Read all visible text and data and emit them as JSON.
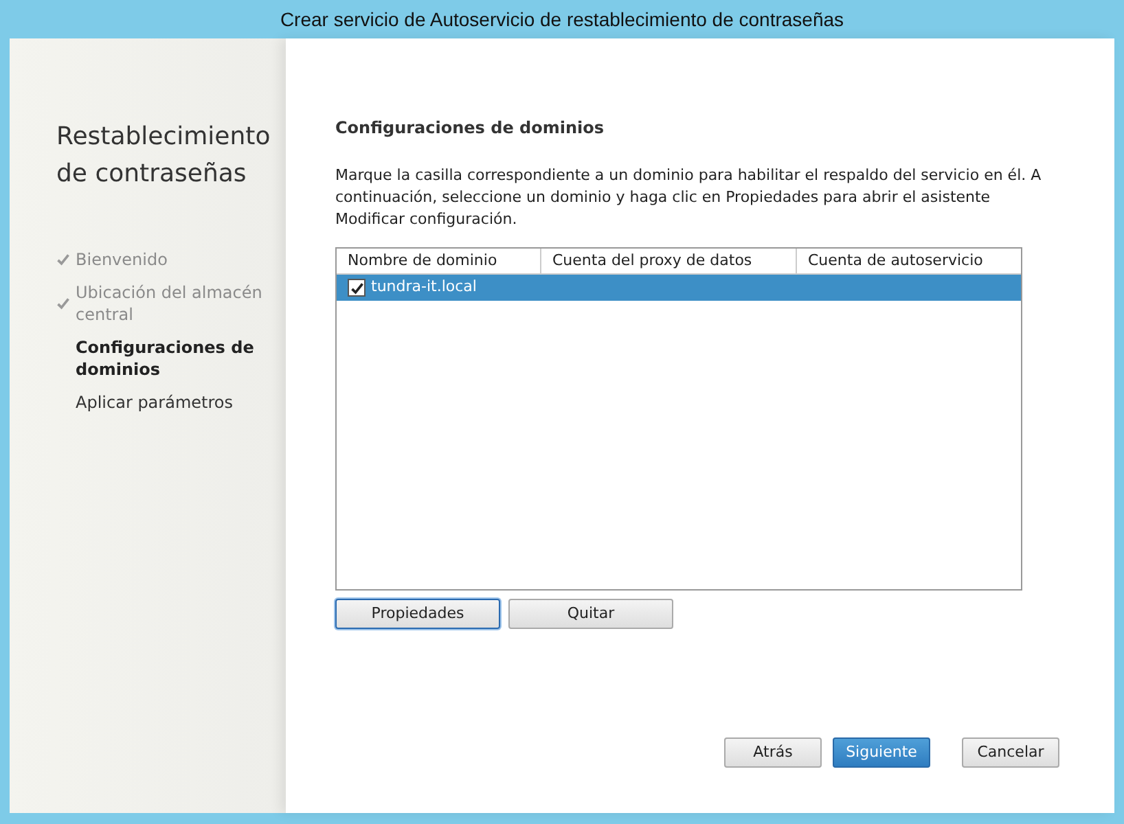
{
  "window": {
    "title": "Crear servicio de Autoservicio de restablecimiento de contraseñas"
  },
  "sidebar": {
    "title": "Restablecimiento de contraseñas",
    "steps": [
      {
        "label": "Bienvenido",
        "kind": "done"
      },
      {
        "label": "Ubicación del almacén central",
        "kind": "done"
      },
      {
        "label": "Configuraciones de dominios",
        "kind": "current"
      },
      {
        "label": "Aplicar parámetros",
        "kind": "pending"
      }
    ]
  },
  "page": {
    "heading": "Configuraciones de dominios",
    "description": "Marque la casilla correspondiente a un dominio para habilitar el respaldo del servicio en él. A continuación, seleccione un dominio y haga clic en Propiedades para abrir el asistente Modificar configuración."
  },
  "table": {
    "columns": [
      "Nombre de dominio",
      "Cuenta del proxy de datos",
      "Cuenta de autoservicio"
    ],
    "rows": [
      {
        "name": "tundra-it.local",
        "checked": true,
        "selected": true
      }
    ]
  },
  "table_buttons": [
    {
      "label": "Propiedades",
      "focused": true
    },
    {
      "label": "Quitar",
      "focused": false
    }
  ],
  "footer_buttons": [
    {
      "label": "Atrás",
      "kind": "default"
    },
    {
      "label": "Siguiente",
      "kind": "primary"
    },
    {
      "label": "Cancelar",
      "kind": "default"
    }
  ]
}
